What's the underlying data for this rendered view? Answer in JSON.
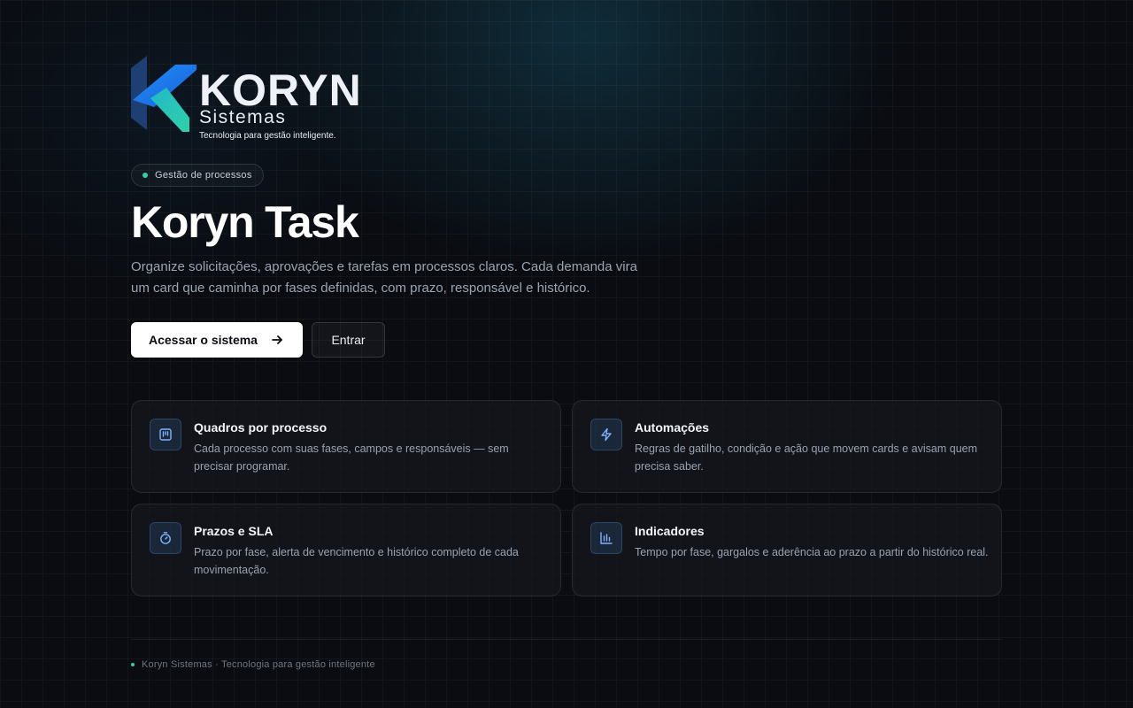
{
  "brand": {
    "logo_wordmark": "KORYN",
    "logo_subtitle": "Sistemas",
    "logo_tagline": "Tecnologia para gestão inteligente.",
    "accent_color": "#2fd1a8",
    "logo_gradient": [
      "#1f8fff",
      "#2fd1a8"
    ]
  },
  "hero": {
    "badge": "Gestão de processos",
    "title": "Koryn Task",
    "description": "Organize solicitações, aprovações e tarefas em processos claros. Cada demanda vira um card que caminha por fases definidas, com prazo, responsável e histórico.",
    "primary_button": "Acessar o sistema",
    "primary_button_icon": "arrow-right-icon",
    "secondary_button": "Entrar"
  },
  "features": [
    {
      "icon": "kanban-board-icon",
      "title": "Quadros por processo",
      "description": "Cada processo com suas fases, campos e responsáveis — sem precisar programar."
    },
    {
      "icon": "lightning-bolt-icon",
      "title": "Automações",
      "description": "Regras de gatilho, condição e ação que movem cards e avisam quem precisa saber."
    },
    {
      "icon": "stopwatch-icon",
      "title": "Prazos e SLA",
      "description": "Prazo por fase, alerta de vencimento e histórico completo de cada movimentação."
    },
    {
      "icon": "bar-chart-icon",
      "title": "Indicadores",
      "description": "Tempo por fase, gargalos e aderência ao prazo a partir do histórico real."
    }
  ],
  "footer": {
    "text": "Koryn Sistemas · Tecnologia para gestão inteligente"
  }
}
